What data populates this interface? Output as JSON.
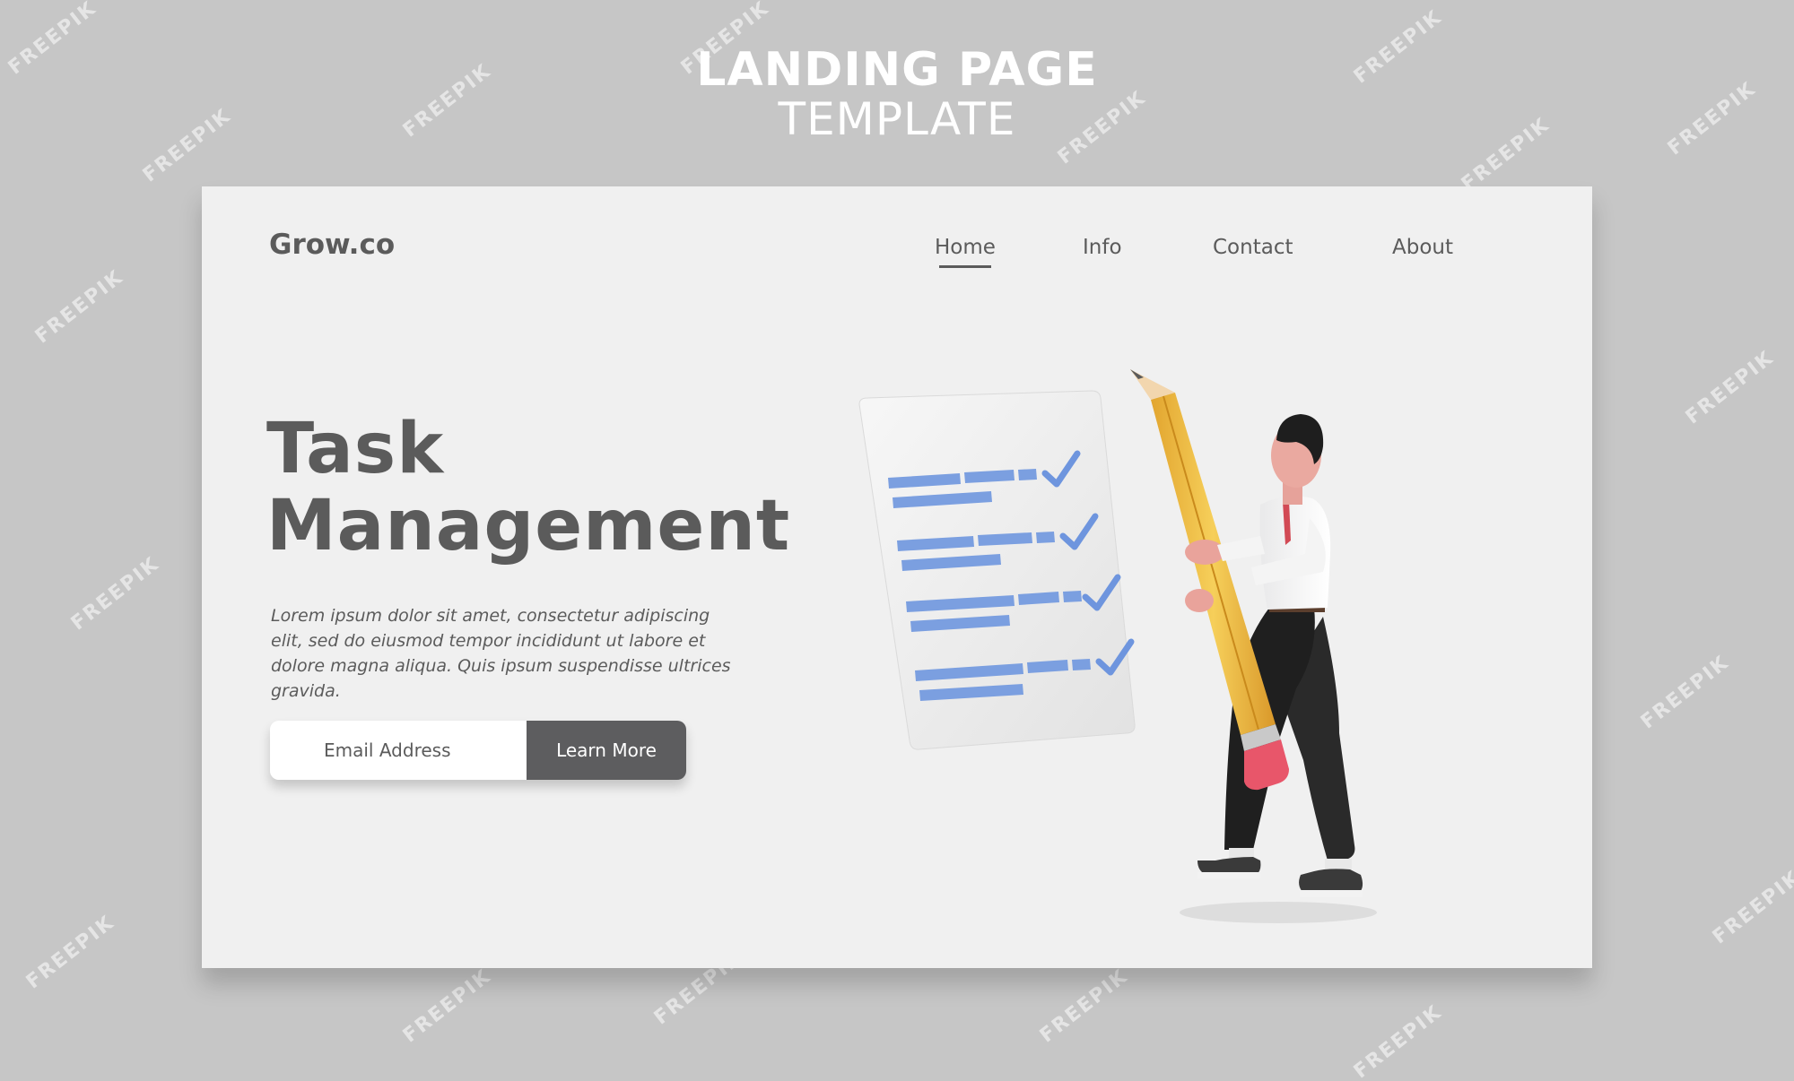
{
  "header": {
    "line1": "LANDING PAGE",
    "line2": "TEMPLATE"
  },
  "watermark": {
    "text": "FREEPIK"
  },
  "site": {
    "brand": "Grow.co",
    "nav": [
      {
        "label": "Home",
        "active": true
      },
      {
        "label": "Info",
        "active": false
      },
      {
        "label": "Contact",
        "active": false
      },
      {
        "label": "About",
        "active": false
      }
    ]
  },
  "hero": {
    "title_line1": "Task",
    "title_line2": "Management",
    "description": "Lorem ipsum dolor sit amet, consectetur adipiscing elit, sed do eiusmod tempor incididunt ut labore et dolore magna aliqua. Quis ipsum suspendisse ultrices gravida."
  },
  "signup": {
    "email_placeholder": "Email Address",
    "button_label": "Learn More"
  },
  "colors": {
    "background": "#c6c6c6",
    "card": "#f0f0f0",
    "text": "#5b5b5b",
    "button": "#5d5d5f",
    "checklist_blue": "#7b9fe0",
    "pencil_yellow": "#f0c04a",
    "eraser_pink": "#e8566a"
  },
  "icons": {
    "checklist": "checklist-document-icon",
    "pencil": "pencil-icon",
    "person": "person-holding-pencil-icon"
  }
}
